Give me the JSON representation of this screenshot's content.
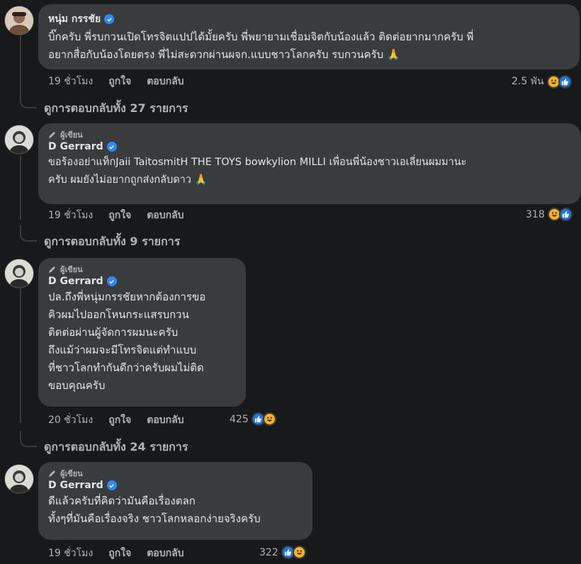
{
  "comments": [
    {
      "name": "หนุ่ม กรรชัย",
      "author_badge": "",
      "lines": [
        "บิ๊กครับ พี่รบกวนเปิดโทรจิตแปปได้มั้ยครับ พี่พยายามเชื่อมจิตกับน้องแล้ว ติดต่อยากมากครับ พี่",
        "อยากสื่อกับน้องโดยตรง พี่ไม่สะดวกผ่านผจก.แบบชาวโลกครับ รบกวนครับ 🙏"
      ],
      "time": "19 ชั่วโมง",
      "like": "ถูกใจ",
      "reply": "ตอบกลับ",
      "reaction_count": "2.5 พัน",
      "replies_text": "ดูการตอบกลับทั้ง 27 รายการ"
    },
    {
      "name": "D Gerrard",
      "author_badge": "ผู้เขียน",
      "lines": [
        "ขอร้องอย่าแท็กJaii TaitosmitH THE TOYS bowkylion MILLI เพื่อนพี่น้องชาวเอเลี่ยนผมมานะ",
        "ครับ ผมยังไม่อยากถูกส่งกลับดาว 🙏"
      ],
      "time": "19 ชั่วโมง",
      "like": "ถูกใจ",
      "reply": "ตอบกลับ",
      "reaction_count": "318",
      "replies_text": "ดูการตอบกลับทั้ง 9 รายการ"
    },
    {
      "name": "D Gerrard",
      "author_badge": "ผู้เขียน",
      "lines": [
        "ปล.ถึงพี่หนุ่มกรรชัยหากต้องการขอ",
        "คิวผมไปออกโหนกระแสรบกวน",
        "ติดต่อผ่านผู้จัดการผมนะครับ",
        "ถึงแม้ว่าผมจะมีโทรจิตแต่ทำแบบ",
        "ที่ชาวโลกทำกันดีกว่าครับผมไม่ติด",
        "ขอบคุณครับ"
      ],
      "time": "20 ชั่วโมง",
      "like": "ถูกใจ",
      "reply": "ตอบกลับ",
      "reaction_count": "425",
      "replies_text": "ดูการตอบกลับทั้ง 24 รายการ"
    },
    {
      "name": "D Gerrard",
      "author_badge": "ผู้เขียน",
      "lines": [
        "ดีแล้วครับที่คิดว่ามันคือเรื่องตลก",
        "ทั้งๆที่มันคือเรื่องจริง ชาวโลกหลอกง่ายจริงครับ"
      ],
      "time": "19 ชั่วโมง",
      "like": "ถูกใจ",
      "reply": "ตอบกลับ",
      "reaction_count": "322",
      "replies_text": ""
    }
  ],
  "colors": {
    "background": "#18191a",
    "bubble": "#3a3b3c",
    "text": "#e4e6eb",
    "secondary": "#b0b3b8",
    "verified": "#2d88ff",
    "like": "#1877f2",
    "haha": "#f7b125"
  },
  "icons": [
    "verified-icon",
    "pencil-icon",
    "like-reaction-icon",
    "haha-reaction-icon",
    "folded-hands-emoji"
  ]
}
